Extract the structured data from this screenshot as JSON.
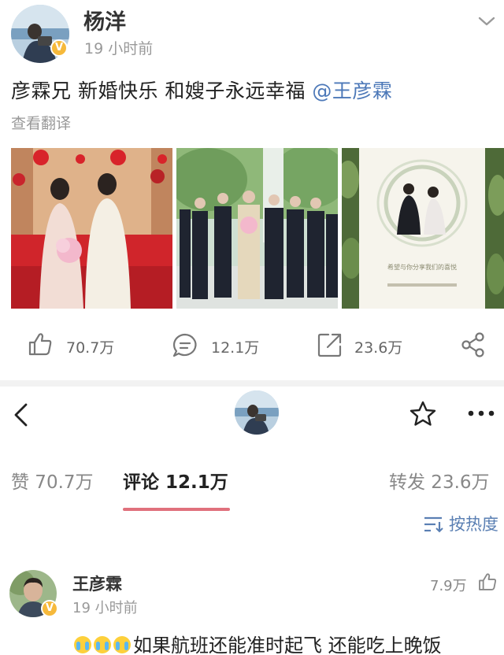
{
  "post": {
    "author": "杨洋",
    "time": "19 小时前",
    "text": "彦霖兄 新婚快乐 和嫂子永远幸福",
    "mention": "@王彦霖",
    "translate": "查看翻译",
    "verified_mark": "V",
    "photos": [
      "wedding-bed-photo",
      "groomsmen-photo",
      "wedding-invitation-photo"
    ],
    "invitation_text": "希望与你分享我们的喜悦"
  },
  "actions": {
    "likes": "70.7万",
    "comments": "12.1万",
    "reposts": "23.6万"
  },
  "tabs": [
    {
      "label": "赞 70.7万"
    },
    {
      "label": "评论 12.1万",
      "active": true
    },
    {
      "label": "转发 23.6万"
    }
  ],
  "sort": {
    "label": "按热度"
  },
  "comment": {
    "author": "王彦霖",
    "time": "19 小时前",
    "likes": "7.9万",
    "text": "如果航班还能准时起飞 还能吃上晚饭",
    "emoji": [
      "crying-face-emoji",
      "crying-face-emoji",
      "crying-face-emoji"
    ]
  },
  "icons": {
    "chevron": "chevron-down-icon",
    "like": "thumbs-up-icon",
    "comment": "comment-bubble-icon",
    "repost": "repost-icon",
    "share": "share-icon",
    "back": "back-arrow-icon",
    "star": "star-icon",
    "more": "more-dots-icon",
    "sort": "sort-icon"
  },
  "colors": {
    "mention": "#4c78b8",
    "tab_underline": "#e0707c",
    "verified_badge": "#f6b93b",
    "sort_link": "#5a7fb3"
  }
}
